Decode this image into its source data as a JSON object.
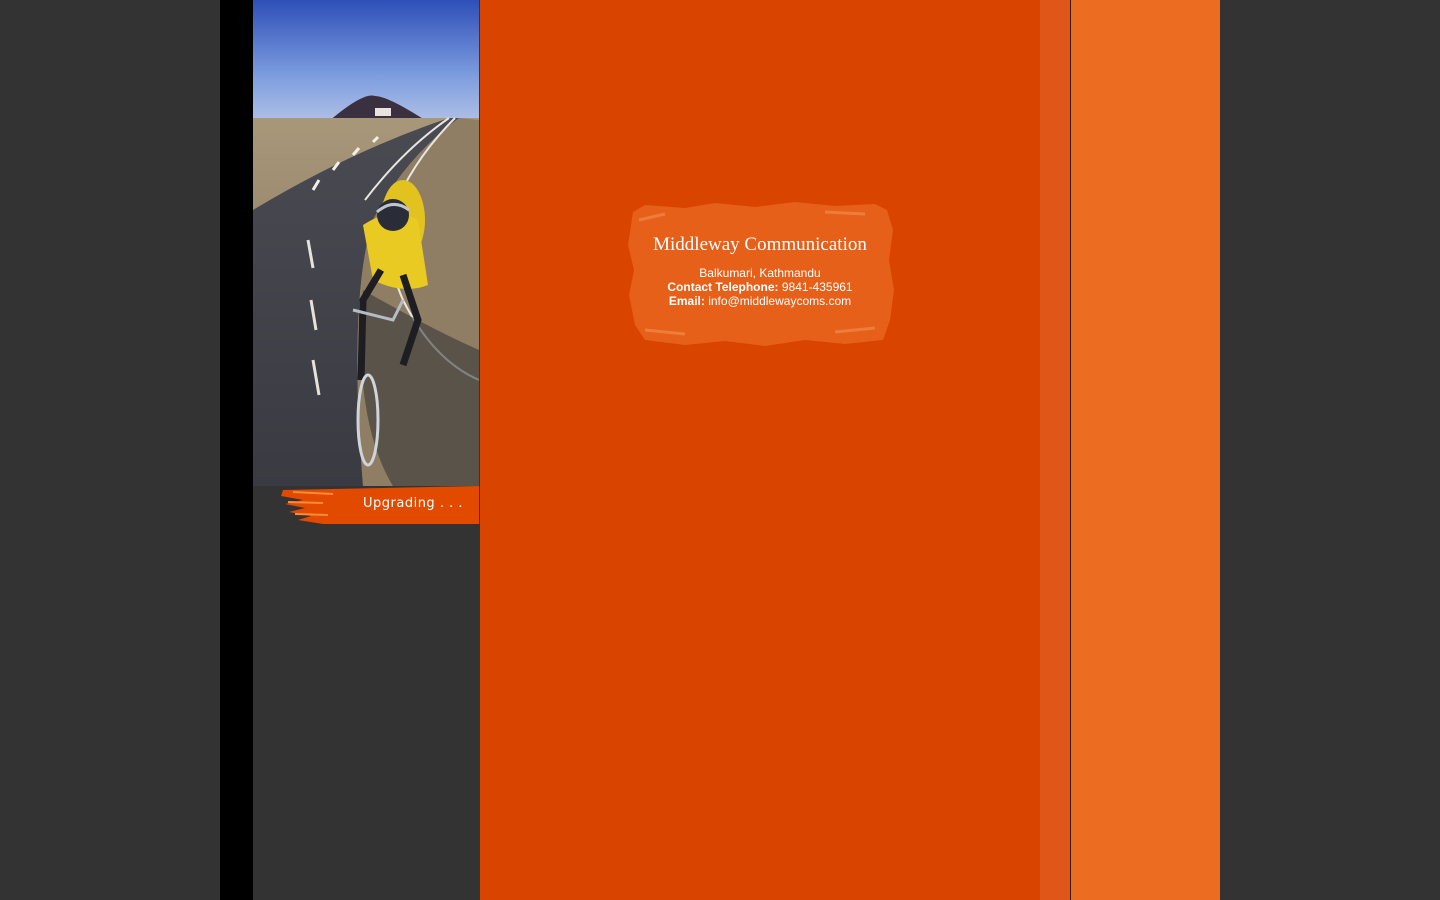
{
  "sidebar": {
    "photo_icon": "cyclist-photo",
    "upgrading_label": "Upgrading . . ."
  },
  "contact": {
    "company_name": "Middleway Communication",
    "address": "Balkumari, Kathmandu",
    "telephone_label": "Contact Telephone:",
    "telephone_value": "9841-435961",
    "email_label": "Email:",
    "email_value": "info@middlewaycoms.com"
  },
  "colors": {
    "page_background": "#333333",
    "main_orange": "#d94400",
    "right_orange": "#ec6c22",
    "strip_orange": "#e05518"
  }
}
